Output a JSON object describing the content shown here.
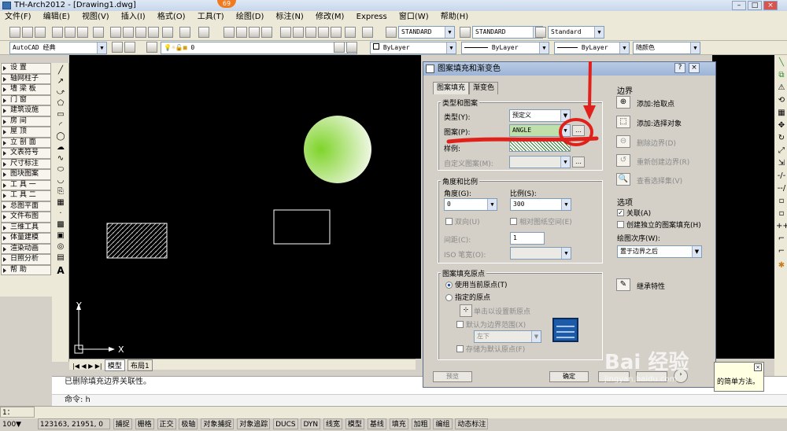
{
  "window": {
    "title": "TH-Arch2012 - [Drawing1.dwg]",
    "badge": "69"
  },
  "menu": [
    "文件(F)",
    "编辑(E)",
    "视图(V)",
    "插入(I)",
    "格式(O)",
    "工具(T)",
    "绘图(D)",
    "标注(N)",
    "修改(M)",
    "Express",
    "窗口(W)",
    "帮助(H)"
  ],
  "toolbar": {
    "textstyle": "STANDARD",
    "dimstyle": "STANDARD",
    "tablestyle": "Standard",
    "workspace": "AutoCAD 经典",
    "layer": "0",
    "color": "ByLayer",
    "linetype": "ByLayer",
    "lineweight": "ByLayer",
    "plotstyle": "随颜色"
  },
  "left_tabs": [
    "设  置",
    "轴网柱子",
    "墙 梁 板",
    "门    窗",
    "建筑设施",
    "房    间",
    "屋    顶",
    "立 剖 面",
    "文表符号",
    "尺寸标注",
    "图块图案",
    "工 具 一",
    "工 具 二",
    "总图平面",
    "文件布图",
    "三维工具",
    "体量建模",
    "渲染动画",
    "日照分析",
    "帮    助"
  ],
  "layout_tabs": {
    "model": "模型",
    "layout": "布局1"
  },
  "command": {
    "history": "已删除填充边界关联性。",
    "prompt": "命令: h"
  },
  "status": {
    "scale": "1：100▼",
    "coords": "123163, 21951, 0",
    "toggles": [
      "捕捉",
      "栅格",
      "正交",
      "极轴",
      "对象捕捉",
      "对象追踪",
      "DUCS",
      "DYN",
      "线宽",
      "模型",
      "基线",
      "填充",
      "加粗",
      "编组",
      "动态标注"
    ]
  },
  "dialog": {
    "title": "图案填充和渐变色",
    "tabs": [
      "图案填充",
      "渐变色"
    ],
    "type_pattern": {
      "group": "类型和图案",
      "type_label": "类型(Y):",
      "type_value": "预定义",
      "pattern_label": "图案(P):",
      "pattern_value": "ANGLE",
      "swatch_label": "样例:",
      "custom_label": "自定义图案(M):"
    },
    "angle_scale": {
      "group": "角度和比例",
      "angle_label": "角度(G):",
      "angle_value": "0",
      "scale_label": "比例(S):",
      "scale_value": "300",
      "double": "双向(U)",
      "relative": "相对图纸空间(E)",
      "spacing_label": "间距(C):",
      "spacing_value": "1",
      "iso_label": "ISO 笔宽(O):"
    },
    "origin": {
      "group": "图案填充原点",
      "use_current": "使用当前原点(T)",
      "specified": "指定的原点",
      "click_set": "单击以设置新原点",
      "default_extent": "默认为边界范围(X)",
      "corner": "左下",
      "store_default": "存储为默认原点(F)"
    },
    "boundary": {
      "group": "边界",
      "add_pick": "添加:拾取点",
      "add_select": "添加:选择对象",
      "remove": "删除边界(D)",
      "recreate": "重新创建边界(R)",
      "view": "查看选择集(V)"
    },
    "options": {
      "group": "选项",
      "associative": "关联(A)",
      "independent": "创建独立的图案填充(H)",
      "draw_order_label": "绘图次序(W):",
      "draw_order_value": "置于边界之后"
    },
    "inherit": "继承特性",
    "buttons": {
      "preview": "预览",
      "ok": "确定"
    }
  },
  "note": "的简单方法。",
  "watermark": {
    "brand": "Bai 经验",
    "url": "jingyan.baidu.com"
  },
  "canvas_axes": {
    "y": "Y",
    "x": "X"
  },
  "colors": {
    "canvas": "#000000",
    "circle": "#9be04a",
    "annotation": "#e0201a",
    "selection": "#c01a16"
  }
}
